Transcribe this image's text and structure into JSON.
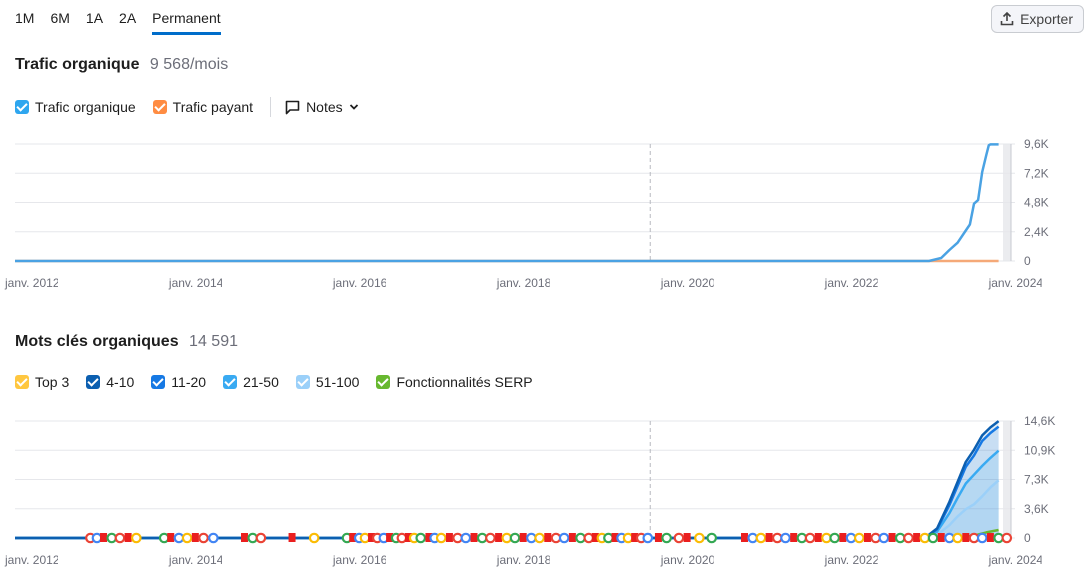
{
  "periods": {
    "tabs": [
      {
        "label": "1M"
      },
      {
        "label": "6M"
      },
      {
        "label": "1A"
      },
      {
        "label": "2A"
      },
      {
        "label": "Permanent"
      }
    ],
    "active": "Permanent"
  },
  "export": {
    "label": "Exporter"
  },
  "traffic": {
    "title": "Trafic organique",
    "value": "9 568/mois",
    "legend": [
      {
        "label": "Trafic organique",
        "color": "#2ea6ef",
        "checked": true
      },
      {
        "label": "Trafic payant",
        "color": "#ff8c42",
        "checked": true
      }
    ],
    "notes_label": "Notes"
  },
  "keywords": {
    "title": "Mots clés organiques",
    "value": "14 591",
    "legend": [
      {
        "label": "Top 3",
        "color": "#ffc740",
        "checked": true
      },
      {
        "label": "4-10",
        "color": "#0c5fb0",
        "checked": true
      },
      {
        "label": "11-20",
        "color": "#1679e4",
        "checked": true
      },
      {
        "label": "21-50",
        "color": "#39aaf2",
        "checked": true
      },
      {
        "label": "51-100",
        "color": "#9bd0f9",
        "checked": true
      },
      {
        "label": "Fonctionnalités SERP",
        "color": "#67b82f",
        "checked": true
      }
    ]
  },
  "chart_data": [
    {
      "type": "line",
      "title": "Trafic organique",
      "x_tick_labels": [
        "janv. 2012",
        "janv. 2014",
        "janv. 2016",
        "janv. 2018",
        "janv. 2020",
        "janv. 2022",
        "janv. 2024"
      ],
      "xlim": [
        2012.0,
        2024.2
      ],
      "y_tick_labels": [
        "0",
        "2,4K",
        "4,8K",
        "7,2K",
        "9,6K"
      ],
      "ylim": [
        0,
        9600
      ],
      "grid": true,
      "marker_x": 2019.75,
      "series": [
        {
          "name": "Trafic organique",
          "color": "#4aa2e3",
          "x": [
            2012.0,
            2023.0,
            2023.15,
            2023.3,
            2023.4,
            2023.5,
            2023.6,
            2023.65,
            2023.7,
            2023.75,
            2023.8,
            2023.85,
            2023.88,
            2023.9,
            2024.0
          ],
          "y": [
            0,
            0,
            0,
            250,
            900,
            1500,
            2500,
            3000,
            4700,
            5000,
            7300,
            8700,
            9500,
            9568,
            9568
          ]
        },
        {
          "name": "Trafic payant",
          "color": "#f5a978",
          "x": [
            2012.0,
            2024.0
          ],
          "y": [
            0,
            0
          ]
        }
      ]
    },
    {
      "type": "area",
      "title": "Mots clés organiques",
      "x_tick_labels": [
        "janv. 2012",
        "janv. 2014",
        "janv. 2016",
        "janv. 2018",
        "janv. 2020",
        "janv. 2022",
        "janv. 2024"
      ],
      "xlim": [
        2012.0,
        2024.2
      ],
      "y_tick_labels": [
        "0",
        "3,6K",
        "7,3K",
        "10,9K",
        "14,6K"
      ],
      "ylim": [
        0,
        14600
      ],
      "grid": true,
      "marker_x": 2019.75,
      "series": [
        {
          "name": "4-10",
          "color": "#0c5fb0",
          "x": [
            2012.0,
            2023.1,
            2023.25,
            2023.4,
            2023.5,
            2023.6,
            2023.7,
            2023.8,
            2023.9,
            2024.0
          ],
          "y": [
            0,
            0,
            1200,
            4500,
            7000,
            9500,
            11000,
            12800,
            13800,
            14591
          ]
        },
        {
          "name": "11-20",
          "color": "#1679e4",
          "x": [
            2012.0,
            2023.1,
            2023.25,
            2023.4,
            2023.5,
            2023.6,
            2023.7,
            2023.8,
            2023.9,
            2024.0
          ],
          "y": [
            0,
            0,
            1100,
            4100,
            6500,
            8900,
            10300,
            12100,
            13100,
            13900
          ]
        },
        {
          "name": "21-50",
          "color": "#39aaf2",
          "x": [
            2012.0,
            2023.1,
            2023.25,
            2023.4,
            2023.5,
            2023.6,
            2023.7,
            2023.8,
            2023.9,
            2024.0
          ],
          "y": [
            0,
            0,
            800,
            3100,
            5000,
            6800,
            7900,
            9000,
            10000,
            10900
          ]
        },
        {
          "name": "51-100",
          "color": "#9bd0f9",
          "x": [
            2012.0,
            2023.1,
            2023.25,
            2023.4,
            2023.5,
            2023.6,
            2023.7,
            2023.8,
            2023.9,
            2024.0
          ],
          "y": [
            0,
            0,
            400,
            1600,
            2700,
            3600,
            4200,
            5200,
            6300,
            7200
          ]
        },
        {
          "name": "Top 3",
          "color": "#ffc740",
          "x": [
            2012.0,
            2024.0
          ],
          "y": [
            0,
            0
          ]
        },
        {
          "name": "Fonctionnalités SERP",
          "color": "#67b82f",
          "x": [
            2012.0,
            2023.5,
            2023.7,
            2023.85,
            2024.0
          ],
          "y": [
            0,
            0,
            300,
            700,
            1000
          ]
        }
      ],
      "google_update_markers": [
        2012.92,
        2013.0,
        2013.08,
        2013.18,
        2013.28,
        2013.38,
        2013.48,
        2013.82,
        2013.9,
        2014.0,
        2014.1,
        2014.2,
        2014.3,
        2014.42,
        2014.8,
        2014.9,
        2015.0,
        2015.38,
        2015.65,
        2016.05,
        2016.12,
        2016.2,
        2016.27,
        2016.35,
        2016.42,
        2016.5,
        2016.57,
        2016.65,
        2016.72,
        2016.8,
        2016.87,
        2016.95,
        2017.05,
        2017.12,
        2017.2,
        2017.3,
        2017.4,
        2017.5,
        2017.6,
        2017.7,
        2017.8,
        2017.9,
        2018.0,
        2018.1,
        2018.2,
        2018.3,
        2018.4,
        2018.5,
        2018.6,
        2018.7,
        2018.8,
        2018.9,
        2019.0,
        2019.08,
        2019.16,
        2019.24,
        2019.32,
        2019.4,
        2019.48,
        2019.56,
        2019.64,
        2019.72,
        2019.85,
        2019.95,
        2020.1,
        2020.2,
        2020.35,
        2020.5,
        2020.9,
        2021.0,
        2021.1,
        2021.2,
        2021.3,
        2021.4,
        2021.5,
        2021.6,
        2021.7,
        2021.8,
        2021.9,
        2022.0,
        2022.1,
        2022.2,
        2022.3,
        2022.4,
        2022.5,
        2022.6,
        2022.7,
        2022.8,
        2022.9,
        2023.0,
        2023.1,
        2023.2,
        2023.3,
        2023.4,
        2023.5,
        2023.6,
        2023.7,
        2023.8,
        2023.9,
        2024.0,
        2024.1
      ]
    }
  ]
}
